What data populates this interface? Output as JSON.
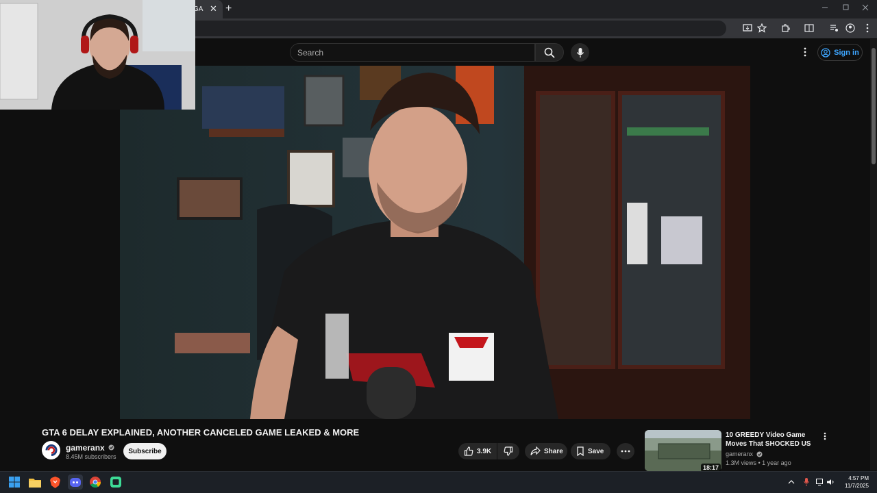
{
  "browser": {
    "tab_title": "GA",
    "tab_close": "✕",
    "new_tab": "+"
  },
  "header": {
    "search_placeholder": "Search",
    "signin_label": "Sign in"
  },
  "video": {
    "title": "GTA 6 DELAY EXPLAINED, ANOTHER CANCELED GAME LEAKED & MORE",
    "channel": "gameranx",
    "subscribers": "8.45M subscribers",
    "subscribe_label": "Subscribe",
    "likes": "3.9K",
    "share_label": "Share",
    "save_label": "Save"
  },
  "recommendation": {
    "title": "10 GREEDY Video Game Moves That SHOCKED US",
    "channel": "gameranx",
    "meta": "1.3M views • 1 year ago",
    "duration": "18:17"
  },
  "taskbar": {
    "time": "4:57 PM",
    "date": "11/7/2025"
  },
  "colors": {
    "accent_link": "#3ea6ff",
    "background": "#0f0f0f",
    "pill": "#272727"
  }
}
